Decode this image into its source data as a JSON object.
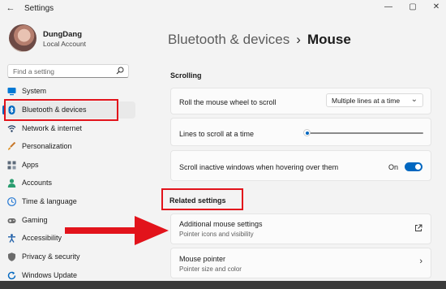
{
  "titlebar": {
    "title": "Settings",
    "back_icon": "back-arrow-icon",
    "minimize": "—",
    "maximize": "▢",
    "close": "✕"
  },
  "user": {
    "name": "DungDang",
    "account": "Local Account"
  },
  "search": {
    "placeholder": "Find a setting",
    "icon": "search-icon"
  },
  "sidebar": {
    "items": [
      {
        "label": "System",
        "icon": "monitor-icon",
        "color": "#0078d4"
      },
      {
        "label": "Bluetooth & devices",
        "icon": "bluetooth-icon",
        "color": "#0067c0",
        "active": true
      },
      {
        "label": "Network & internet",
        "icon": "wifi-icon",
        "color": "#1f3a60"
      },
      {
        "label": "Personalization",
        "icon": "brush-icon",
        "color": "#c7772a"
      },
      {
        "label": "Apps",
        "icon": "apps-icon",
        "color": "#5c6a7a"
      },
      {
        "label": "Accounts",
        "icon": "person-icon",
        "color": "#2a9d6f"
      },
      {
        "label": "Time & language",
        "icon": "globe-clock-icon",
        "color": "#2a7bd4"
      },
      {
        "label": "Gaming",
        "icon": "gamepad-icon",
        "color": "#6b6b6b"
      },
      {
        "label": "Accessibility",
        "icon": "accessibility-icon",
        "color": "#1f5fa8"
      },
      {
        "label": "Privacy & security",
        "icon": "shield-icon",
        "color": "#6b6b6b"
      },
      {
        "label": "Windows Update",
        "icon": "update-icon",
        "color": "#0067c0"
      }
    ]
  },
  "breadcrumb": {
    "parent": "Bluetooth & devices",
    "separator": "›",
    "current": "Mouse"
  },
  "scrolling": {
    "heading": "Scrolling",
    "roll_label": "Roll the mouse wheel to scroll",
    "roll_value": "Multiple lines at a time",
    "lines_label": "Lines to scroll at a time",
    "lines_level": 0.03,
    "inactive_label": "Scroll inactive windows when hovering over them",
    "inactive_state": "On"
  },
  "related": {
    "heading": "Related settings",
    "items": [
      {
        "title": "Additional mouse settings",
        "subtitle": "Pointer icons and visibility",
        "icon": "external-link-icon"
      },
      {
        "title": "Mouse pointer",
        "subtitle": "Pointer size and color",
        "icon": "chevron-right-icon"
      }
    ]
  },
  "colors": {
    "accent": "#0067c0",
    "highlight": "#e2131b"
  }
}
